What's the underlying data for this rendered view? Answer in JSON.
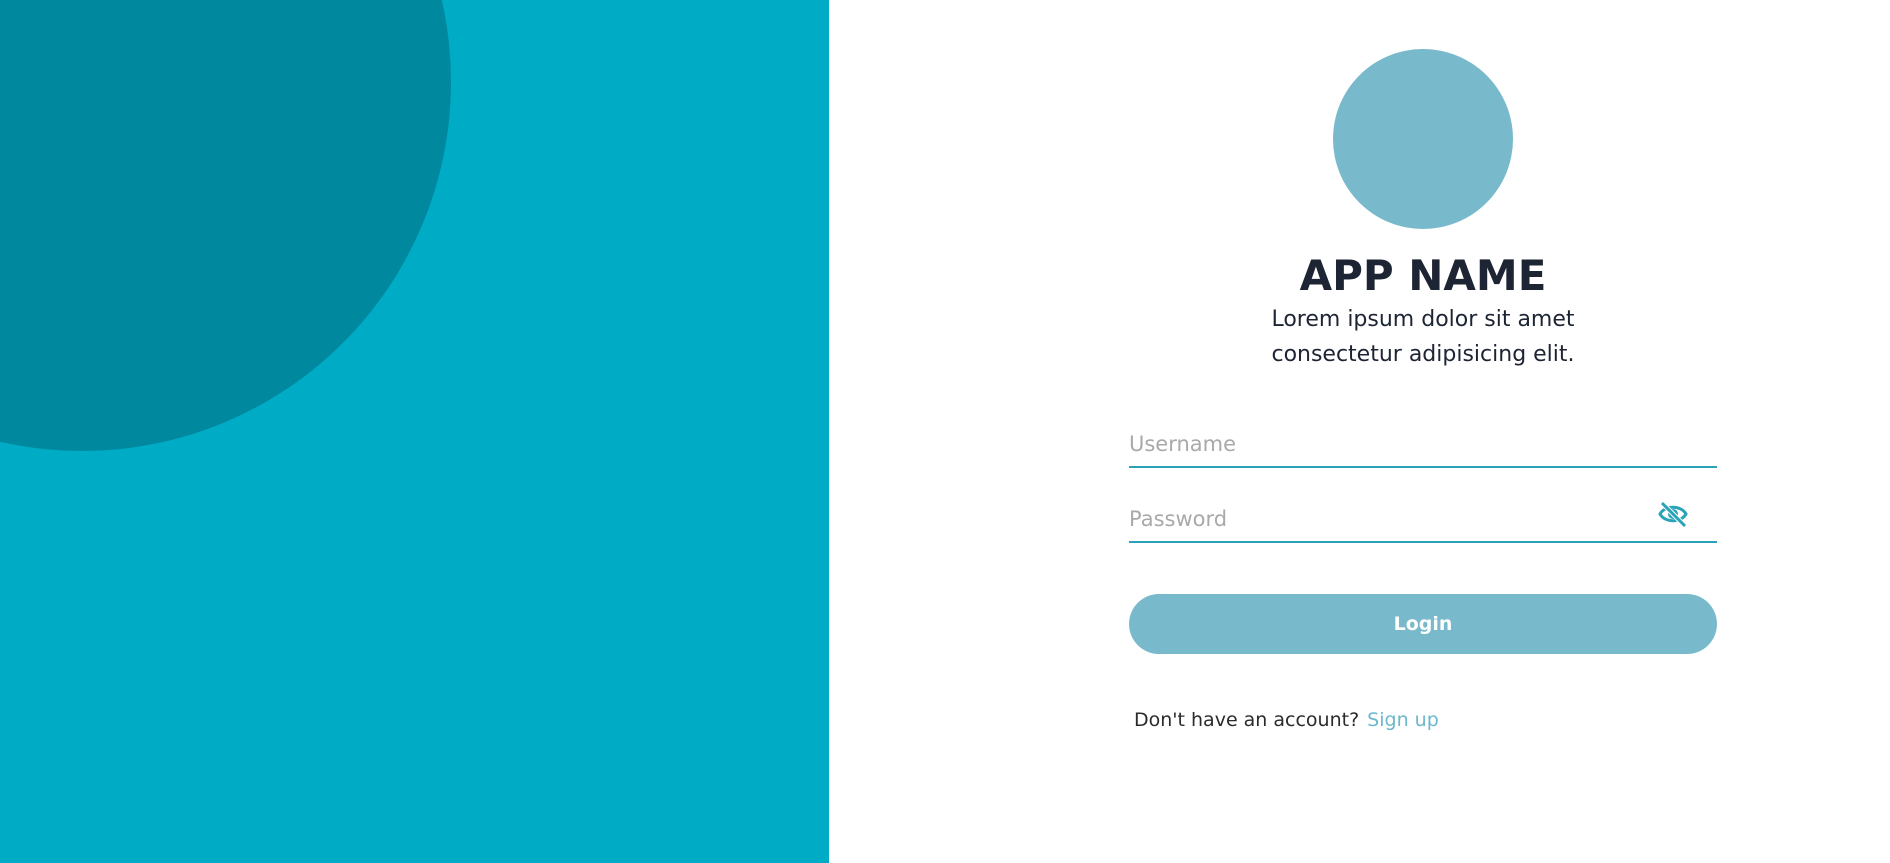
{
  "colors": {
    "left_panel": "#00abc5",
    "decor_circle": "#00889f",
    "logo_circle": "#78b9cb",
    "input_underline": "#2aa3b9",
    "login_button": "#78b9cb",
    "signup_link": "#6cb8cc",
    "title_text": "#1d2433"
  },
  "brand": {
    "app_name": "APP NAME",
    "tagline_line1": "Lorem ipsum dolor sit amet",
    "tagline_line2": "consectetur adipisicing elit."
  },
  "form": {
    "username_placeholder": "Username",
    "username_value": "",
    "password_placeholder": "Password",
    "password_value": "",
    "password_toggle_icon": "eye-slash-icon",
    "login_label": "Login"
  },
  "footer": {
    "prompt": "Don't have an account?",
    "signup_label": "Sign up"
  }
}
